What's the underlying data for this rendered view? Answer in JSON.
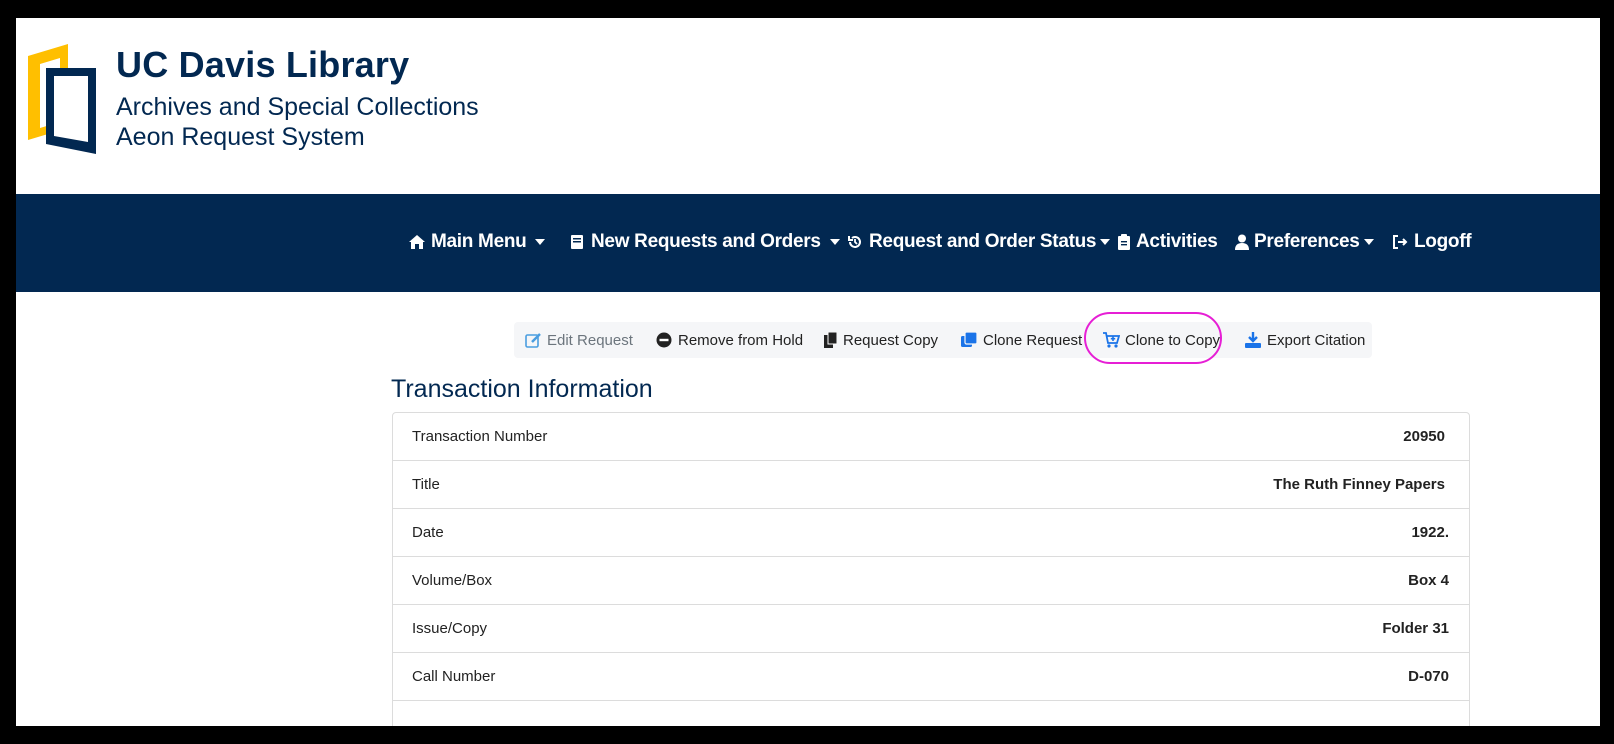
{
  "brand": {
    "title": "UC Davis Library",
    "subtitle_line1": "Archives and Special Collections",
    "subtitle_line2": "Aeon Request System",
    "colors": {
      "navy": "#022851",
      "gold": "#FFBF00"
    }
  },
  "nav": {
    "items": [
      {
        "label": "Main Menu",
        "icon": "home-icon",
        "dropdown": true
      },
      {
        "label": "New Requests and Orders",
        "icon": "book-icon",
        "dropdown": true
      },
      {
        "label": "Request and Order Status",
        "icon": "history-icon",
        "dropdown": true
      },
      {
        "label": "Activities",
        "icon": "clipboard-icon",
        "dropdown": false
      },
      {
        "label": "Preferences",
        "icon": "user-icon",
        "dropdown": true
      },
      {
        "label": "Logoff",
        "icon": "logoff-icon",
        "dropdown": false
      }
    ]
  },
  "toolbar": {
    "edit_request": "Edit Request",
    "remove_from_hold": "Remove from Hold",
    "request_copy": "Request Copy",
    "clone_request": "Clone Request",
    "clone_to_copy": "Clone to Copy",
    "export_citation": "Export Citation",
    "highlight_color": "#e61fd5"
  },
  "transaction": {
    "heading": "Transaction Information",
    "rows": [
      {
        "label": "Transaction Number",
        "value": "20950"
      },
      {
        "label": "Title",
        "value": "The Ruth Finney Papers"
      },
      {
        "label": "Date",
        "value": "1922."
      },
      {
        "label": "Volume/Box",
        "value": "Box 4"
      },
      {
        "label": "Issue/Copy",
        "value": "Folder 31"
      },
      {
        "label": "Call Number",
        "value": "D-070"
      }
    ]
  }
}
